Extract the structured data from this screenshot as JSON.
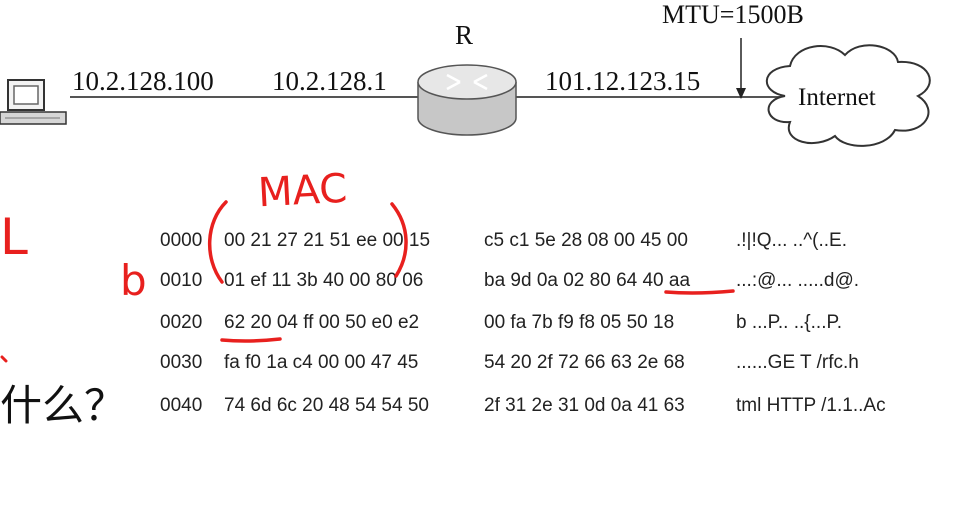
{
  "network": {
    "host_ip": "10.2.128.100",
    "router_ip_in": "10.2.128.1",
    "router_label": "R",
    "router_ip_out": "101.12.123.15",
    "mtu_label": "MTU=1500B",
    "cloud_label": "Internet",
    "icons": [
      "computer-icon",
      "router-icon",
      "cloud-icon"
    ]
  },
  "hexdump": [
    {
      "offset": "0000",
      "hex1": "00 21 27 21 51 ee 00 15",
      "hex2": "c5 c1 5e 28 08 00 45 00",
      "ascii": ".!|!Q... ..^(..E."
    },
    {
      "offset": "0010",
      "hex1": "01 ef 11 3b 40 00 80 06",
      "hex2": "ba 9d 0a 02 80 64 40 aa",
      "ascii": "...:@... .....d@."
    },
    {
      "offset": "0020",
      "hex1": "62 20 04 ff 00 50 e0 e2",
      "hex2": "00 fa 7b f9 f8 05 50 18",
      "ascii": "b ...P.. ..{...P."
    },
    {
      "offset": "0030",
      "hex1": "fa f0 1a c4 00 00 47 45",
      "hex2": "54 20 2f 72 66 63 2e 68",
      "ascii": "......GE T /rfc.h"
    },
    {
      "offset": "0040",
      "hex1": "74 6d 6c 20 48 54 54 50",
      "hex2": "2f 31 2e 31 0d 0a 41 63",
      "ascii": "tml HTTP /1.1..Ac"
    }
  ],
  "annotations": {
    "mac": "MAC",
    "left_letter": "L",
    "b_letter": "b",
    "question": "什么？"
  },
  "colors": {
    "handwriting": "#e8201e",
    "text": "#222222"
  }
}
